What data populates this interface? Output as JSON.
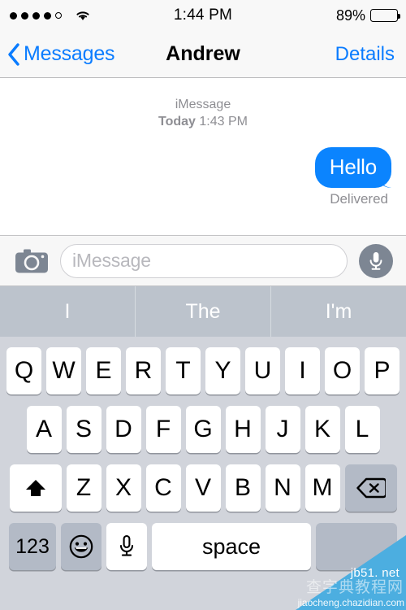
{
  "status_bar": {
    "signal_dots_filled": 4,
    "signal_dots_total": 5,
    "wifi_icon": "wifi-icon",
    "time": "1:44 PM",
    "battery_percent": "89%",
    "battery_level": 89
  },
  "nav_bar": {
    "back_icon": "chevron-left-icon",
    "back_label": "Messages",
    "title": "Andrew",
    "details_label": "Details"
  },
  "conversation": {
    "service_label": "iMessage",
    "day_label": "Today",
    "time_label": "1:43 PM",
    "messages": [
      {
        "text": "Hello",
        "side": "outgoing",
        "status": "Delivered",
        "bubble_color": "#0b84fe"
      }
    ]
  },
  "input_bar": {
    "camera_icon": "camera-icon",
    "placeholder": "iMessage",
    "value": "",
    "mic_icon": "microphone-icon"
  },
  "predictive_bar": {
    "suggestions": [
      "I",
      "The",
      "I'm"
    ]
  },
  "keyboard": {
    "row1": [
      "Q",
      "W",
      "E",
      "R",
      "T",
      "Y",
      "U",
      "I",
      "O",
      "P"
    ],
    "row2": [
      "A",
      "S",
      "D",
      "F",
      "G",
      "H",
      "J",
      "K",
      "L"
    ],
    "row3_letters": [
      "Z",
      "X",
      "C",
      "V",
      "B",
      "N",
      "M"
    ],
    "shift_icon": "shift-up-arrow-icon",
    "delete_icon": "backspace-delete-icon",
    "numbers_label": "123",
    "emoji_icon": "smiley-face-icon",
    "dictation_icon": "microphone-icon",
    "space_label": "space",
    "return_label": ""
  },
  "watermark": {
    "site": "jb51. net",
    "brand_cn": "查字典教程网",
    "url": "jiaocheng.chazidian.com",
    "color": "#4caee0"
  },
  "colors": {
    "accent_blue": "#0a7cff",
    "bubble_blue": "#0b84fe",
    "keyboard_bg": "#d1d4db",
    "key_gray": "#b3bac6",
    "predictive_bg": "#bcc3cc"
  }
}
